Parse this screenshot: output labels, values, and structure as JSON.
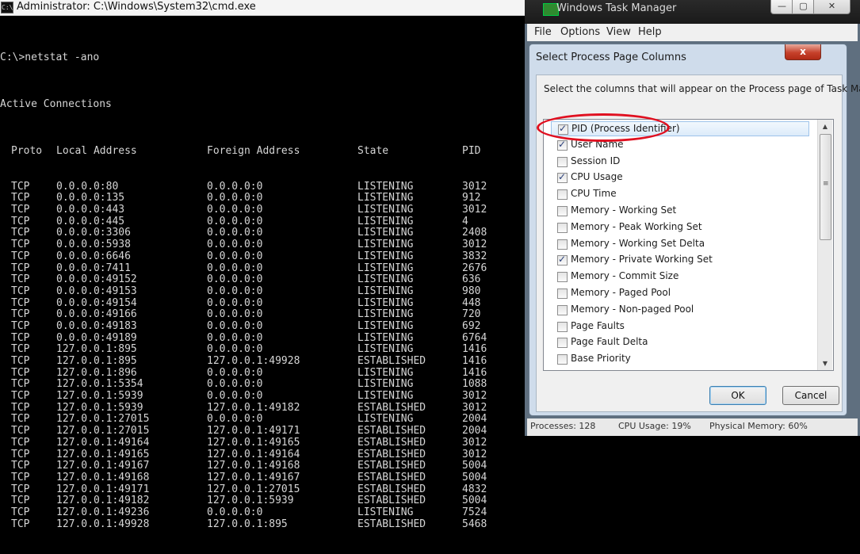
{
  "cmd": {
    "title": "Administrator: C:\\Windows\\System32\\cmd.exe",
    "icon_text": "C:\\",
    "prompt_line": "C:\\>netstat -ano",
    "active_heading": "Active Connections",
    "headers": {
      "proto": "Proto",
      "local": "Local Address",
      "foreign": "Foreign Address",
      "state": "State",
      "pid": "PID"
    },
    "rows": [
      [
        "TCP",
        "0.0.0.0:80",
        "0.0.0.0:0",
        "LISTENING",
        "3012"
      ],
      [
        "TCP",
        "0.0.0.0:135",
        "0.0.0.0:0",
        "LISTENING",
        "912"
      ],
      [
        "TCP",
        "0.0.0.0:443",
        "0.0.0.0:0",
        "LISTENING",
        "3012"
      ],
      [
        "TCP",
        "0.0.0.0:445",
        "0.0.0.0:0",
        "LISTENING",
        "4"
      ],
      [
        "TCP",
        "0.0.0.0:3306",
        "0.0.0.0:0",
        "LISTENING",
        "2408"
      ],
      [
        "TCP",
        "0.0.0.0:5938",
        "0.0.0.0:0",
        "LISTENING",
        "3012"
      ],
      [
        "TCP",
        "0.0.0.0:6646",
        "0.0.0.0:0",
        "LISTENING",
        "3832"
      ],
      [
        "TCP",
        "0.0.0.0:7411",
        "0.0.0.0:0",
        "LISTENING",
        "2676"
      ],
      [
        "TCP",
        "0.0.0.0:49152",
        "0.0.0.0:0",
        "LISTENING",
        "636"
      ],
      [
        "TCP",
        "0.0.0.0:49153",
        "0.0.0.0:0",
        "LISTENING",
        "980"
      ],
      [
        "TCP",
        "0.0.0.0:49154",
        "0.0.0.0:0",
        "LISTENING",
        "448"
      ],
      [
        "TCP",
        "0.0.0.0:49166",
        "0.0.0.0:0",
        "LISTENING",
        "720"
      ],
      [
        "TCP",
        "0.0.0.0:49183",
        "0.0.0.0:0",
        "LISTENING",
        "692"
      ],
      [
        "TCP",
        "0.0.0.0:49189",
        "0.0.0.0:0",
        "LISTENING",
        "6764"
      ],
      [
        "TCP",
        "127.0.0.1:895",
        "0.0.0.0:0",
        "LISTENING",
        "1416"
      ],
      [
        "TCP",
        "127.0.0.1:895",
        "127.0.0.1:49928",
        "ESTABLISHED",
        "1416"
      ],
      [
        "TCP",
        "127.0.0.1:896",
        "0.0.0.0:0",
        "LISTENING",
        "1416"
      ],
      [
        "TCP",
        "127.0.0.1:5354",
        "0.0.0.0:0",
        "LISTENING",
        "1088"
      ],
      [
        "TCP",
        "127.0.0.1:5939",
        "0.0.0.0:0",
        "LISTENING",
        "3012"
      ],
      [
        "TCP",
        "127.0.0.1:5939",
        "127.0.0.1:49182",
        "ESTABLISHED",
        "3012"
      ],
      [
        "TCP",
        "127.0.0.1:27015",
        "0.0.0.0:0",
        "LISTENING",
        "2004"
      ],
      [
        "TCP",
        "127.0.0.1:27015",
        "127.0.0.1:49171",
        "ESTABLISHED",
        "2004"
      ],
      [
        "TCP",
        "127.0.0.1:49164",
        "127.0.0.1:49165",
        "ESTABLISHED",
        "3012"
      ],
      [
        "TCP",
        "127.0.0.1:49165",
        "127.0.0.1:49164",
        "ESTABLISHED",
        "3012"
      ],
      [
        "TCP",
        "127.0.0.1:49167",
        "127.0.0.1:49168",
        "ESTABLISHED",
        "5004"
      ],
      [
        "TCP",
        "127.0.0.1:49168",
        "127.0.0.1:49167",
        "ESTABLISHED",
        "5004"
      ],
      [
        "TCP",
        "127.0.0.1:49171",
        "127.0.0.1:27015",
        "ESTABLISHED",
        "4832"
      ],
      [
        "TCP",
        "127.0.0.1:49182",
        "127.0.0.1:5939",
        "ESTABLISHED",
        "5004"
      ],
      [
        "TCP",
        "127.0.0.1:49236",
        "0.0.0.0:0",
        "LISTENING",
        "7524"
      ],
      [
        "TCP",
        "127.0.0.1:49928",
        "127.0.0.1:895",
        "ESTABLISHED",
        "5468"
      ]
    ]
  },
  "taskmgr": {
    "title": "Windows Task Manager",
    "window_buttons": {
      "minimize": "—",
      "maximize": "▢",
      "close": "✕"
    },
    "menu": [
      "File",
      "Options",
      "View",
      "Help"
    ],
    "status": {
      "processes": "Processes: 128",
      "cpu": "CPU Usage: 19%",
      "memory": "Physical Memory: 60%"
    }
  },
  "dialog": {
    "title": "Select Process Page Columns",
    "close_label": "x",
    "description": "Select the columns that will appear on the Process page of Task Manager.",
    "columns": [
      {
        "label": "PID (Process Identifier)",
        "checked": true,
        "selected": true
      },
      {
        "label": "User Name",
        "checked": true
      },
      {
        "label": "Session ID",
        "checked": false
      },
      {
        "label": "CPU Usage",
        "checked": true
      },
      {
        "label": "CPU Time",
        "checked": false
      },
      {
        "label": "Memory - Working Set",
        "checked": false
      },
      {
        "label": "Memory - Peak Working Set",
        "checked": false
      },
      {
        "label": "Memory - Working Set Delta",
        "checked": false
      },
      {
        "label": "Memory - Private Working Set",
        "checked": true
      },
      {
        "label": "Memory - Commit Size",
        "checked": false
      },
      {
        "label": "Memory - Paged Pool",
        "checked": false
      },
      {
        "label": "Memory - Non-paged Pool",
        "checked": false
      },
      {
        "label": "Page Faults",
        "checked": false
      },
      {
        "label": "Page Fault Delta",
        "checked": false
      },
      {
        "label": "Base Priority",
        "checked": false
      }
    ],
    "ok_label": "OK",
    "cancel_label": "Cancel",
    "scroll_up": "▲",
    "scroll_down": "▼",
    "grip": "≡"
  },
  "colors": {
    "annotation": "#e01020",
    "console_text": "#d6d6d6",
    "dialog_frame": "#cfdceb"
  }
}
